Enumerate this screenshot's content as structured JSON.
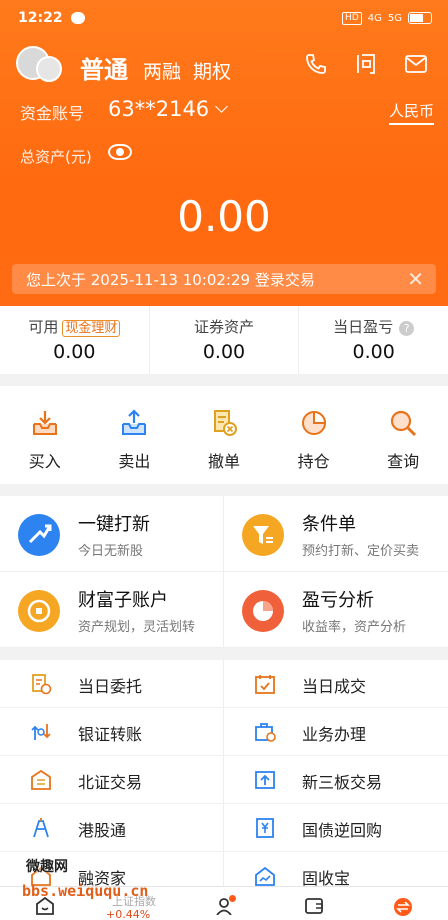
{
  "status": {
    "time": "12:22",
    "signal1": "HD",
    "net1": "4G",
    "net2": "5G"
  },
  "header": {
    "account_type": "普通",
    "links": [
      "两融",
      "期权"
    ],
    "account_label": "资金账号",
    "account_number": "63**2146",
    "currency": "人民币",
    "total_label": "总资产(元)",
    "total_value": "0.00",
    "notice": "您上次于 2025-11-13  10:02:29 登录交易"
  },
  "summary": [
    {
      "label": "可用",
      "badge": "现金理财",
      "value": "0.00"
    },
    {
      "label": "证券资产",
      "value": "0.00"
    },
    {
      "label": "当日盈亏",
      "value": "0.00"
    }
  ],
  "actions": [
    "买入",
    "卖出",
    "撤单",
    "持仓",
    "查询"
  ],
  "cards": [
    {
      "title": "一键打新",
      "sub": "今日无新股",
      "color": "#2d83f0"
    },
    {
      "title": "条件单",
      "sub": "预约打新、定价买卖",
      "color": "#f5a623"
    },
    {
      "title": "财富子账户",
      "sub": "资产规划，灵活划转",
      "color": "#f5a623"
    },
    {
      "title": "盈亏分析",
      "sub": "收益率，资产分析",
      "color": "#f0603a"
    }
  ],
  "list": [
    "当日委托",
    "当日成交",
    "银证转账",
    "业务办理",
    "北证交易",
    "新三板交易",
    "港股通",
    "国债逆回购",
    "融资家",
    "固收宝"
  ],
  "tabbar": {
    "index_name": "上证指数",
    "index_change": "+0.44%"
  },
  "watermark": {
    "line1": "微趣网",
    "line2": "bbs.weiququ.cn"
  },
  "colors": {
    "brand": "#ff6a10",
    "icon_orange": "#e8731a",
    "icon_blue": "#2d83f0"
  }
}
